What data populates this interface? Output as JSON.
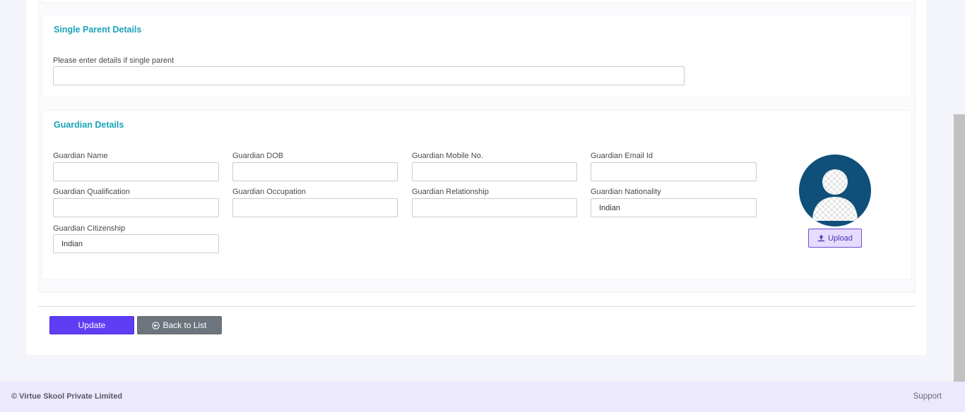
{
  "single_parent": {
    "title": "Single Parent Details",
    "field_label": "Please enter details if single parent",
    "field_value": ""
  },
  "guardian": {
    "title": "Guardian Details",
    "fields": {
      "name": {
        "label": "Guardian Name",
        "value": ""
      },
      "dob": {
        "label": "Guardian DOB",
        "value": ""
      },
      "mobile": {
        "label": "Guardian Mobile No.",
        "value": ""
      },
      "email": {
        "label": "Guardian Email Id",
        "value": ""
      },
      "qualification": {
        "label": "Guardian Qualification",
        "value": ""
      },
      "occupation": {
        "label": "Guardian Occupation",
        "value": ""
      },
      "relationship": {
        "label": "Guardian Relationship",
        "value": ""
      },
      "nationality": {
        "label": "Guardian Nationality",
        "value": "Indian"
      },
      "citizenship": {
        "label": "Guardian Citizenship",
        "value": "Indian"
      }
    },
    "upload_label": "Upload",
    "avatar_icon": "user-avatar-icon",
    "upload_icon": "upload-icon"
  },
  "actions": {
    "update_label": "Update",
    "back_label": "Back to List",
    "back_icon": "arrow-left-circle-icon"
  },
  "footer": {
    "copyright": "© Virtue Skool Private Limited",
    "support": "Support"
  },
  "colors": {
    "section_title": "#1aa3b8",
    "update_button": "#5f3df5",
    "back_button": "#6c757d",
    "avatar_bg": "#0f4f7a",
    "upload_bg": "#e6dcff",
    "footer_bg": "#ece8fd"
  }
}
